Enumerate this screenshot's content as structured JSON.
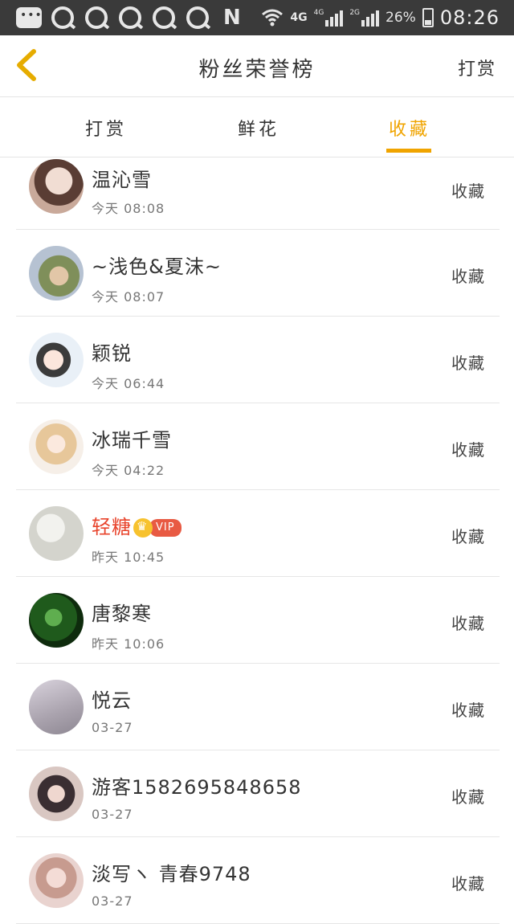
{
  "status_bar": {
    "network": "4G",
    "sim1": "4G",
    "sim2": "2G",
    "battery": "26%",
    "time": "08:26"
  },
  "header": {
    "title": "粉丝荣誉榜",
    "right_action": "打赏"
  },
  "tabs": [
    {
      "label": "打赏",
      "active": false
    },
    {
      "label": "鲜花",
      "active": false
    },
    {
      "label": "收藏",
      "active": true
    }
  ],
  "accent_color": "#f0a400",
  "fans": [
    {
      "name": "温沁雪",
      "time": "今天 08:08",
      "action": "收藏",
      "avatar_color": "#c9a99a",
      "vip": false
    },
    {
      "name": "~浅色&夏沫~",
      "time": "今天 08:07",
      "action": "收藏",
      "avatar_color": "#a8b07a",
      "vip": false
    },
    {
      "name": "颖锐",
      "time": "今天 06:44",
      "action": "收藏",
      "avatar_color": "#d7e4ef",
      "vip": false
    },
    {
      "name": "冰瑞千雪",
      "time": "今天 04:22",
      "action": "收藏",
      "avatar_color": "#efd9c7",
      "vip": false
    },
    {
      "name": "轻糖",
      "time": "昨天 10:45",
      "action": "收藏",
      "avatar_color": "#dcdcd6",
      "vip": true,
      "vip_label": "VIP"
    },
    {
      "name": "唐黎寒",
      "time": "昨天 10:06",
      "action": "收藏",
      "avatar_color": "#2f7a2a",
      "vip": false
    },
    {
      "name": "悦云",
      "time": "03-27",
      "action": "收藏",
      "avatar_color": "#b9b3bd",
      "vip": false
    },
    {
      "name": "游客15826958486​58",
      "time": "03-27",
      "action": "收藏",
      "avatar_color": "#c9b6b0",
      "vip": false
    },
    {
      "name": "淡写ヽ 青春9748",
      "time": "03-27",
      "action": "收藏",
      "avatar_color": "#d9b9b4",
      "vip": false
    }
  ]
}
